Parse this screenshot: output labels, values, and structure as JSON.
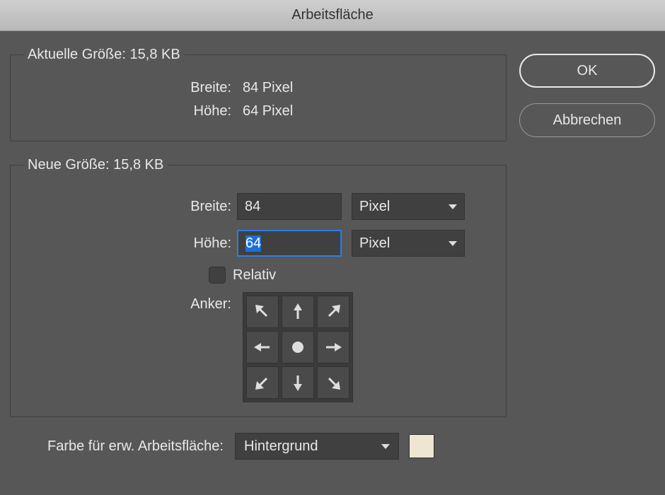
{
  "window": {
    "title": "Arbeitsfläche"
  },
  "buttons": {
    "ok": "OK",
    "cancel": "Abbrechen"
  },
  "current_size": {
    "legend_prefix": "Aktuelle Größe: ",
    "size": "15,8 KB",
    "width_label": "Breite:",
    "width_value": "84 Pixel",
    "height_label": "Höhe:",
    "height_value": "64 Pixel"
  },
  "new_size": {
    "legend_prefix": "Neue Größe: ",
    "size": "15,8 KB",
    "width_label": "Breite:",
    "width_value": "84",
    "width_unit": "Pixel",
    "height_label": "Höhe:",
    "height_value": "64",
    "height_unit": "Pixel",
    "relative_label": "Relativ",
    "relative_checked": false,
    "anchor_label": "Anker:",
    "anchor_position": "center"
  },
  "extension_color": {
    "label": "Farbe für erw. Arbeitsfläche:",
    "value": "Hintergrund",
    "swatch": "#eee6d3"
  }
}
